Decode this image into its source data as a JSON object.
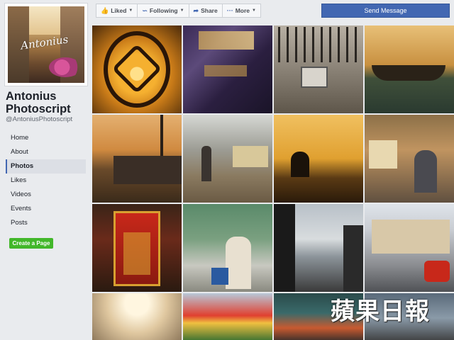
{
  "page": {
    "name": "Antonius Photoscript",
    "handle": "@AntoniusPhotoscript"
  },
  "nav": [
    {
      "label": "Home",
      "active": false
    },
    {
      "label": "About",
      "active": false
    },
    {
      "label": "Photos",
      "active": true
    },
    {
      "label": "Likes",
      "active": false
    },
    {
      "label": "Videos",
      "active": false
    },
    {
      "label": "Events",
      "active": false
    },
    {
      "label": "Posts",
      "active": false
    }
  ],
  "create_page_label": "Create a Page",
  "actions": {
    "liked": "Liked",
    "following": "Following",
    "share": "Share",
    "more": "More",
    "send_message": "Send Message"
  },
  "icons": {
    "liked": "thumbs-up-icon",
    "following": "rss-icon",
    "share": "share-arrow-icon",
    "more": "ellipsis-icon"
  },
  "colors": {
    "brand_blue": "#4267b2",
    "create_green": "#42b72a",
    "background": "#e9ebee"
  },
  "watermark": "蘋果日報"
}
